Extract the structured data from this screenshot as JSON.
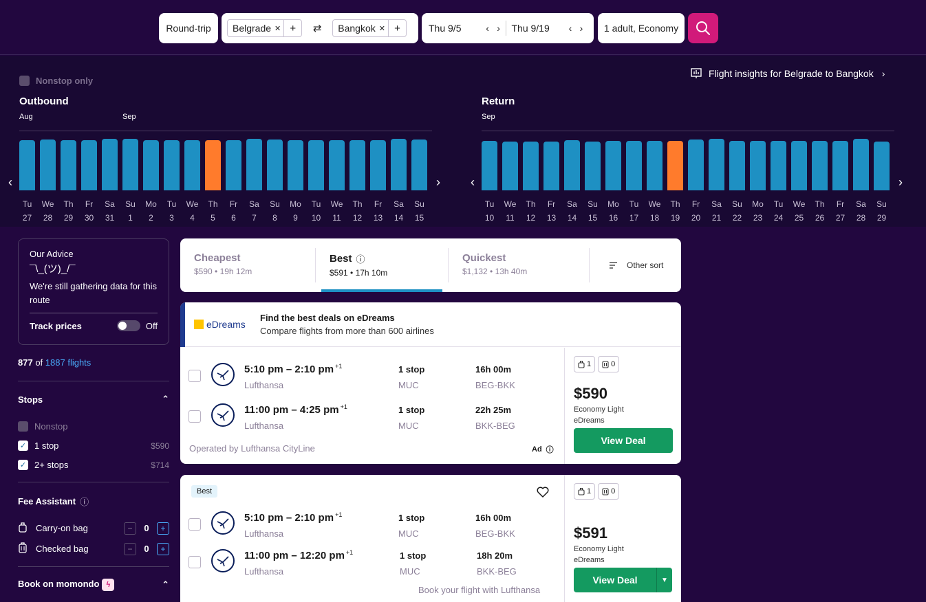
{
  "search": {
    "trip_type": "Round-trip",
    "origin": "Belgrade",
    "destination": "Bangkok",
    "depart_date": "Thu 9/5",
    "return_date": "Thu 9/19",
    "passengers": "1 adult, Economy",
    "remove_glyph": "✕",
    "add_glyph": "+",
    "swap_glyph": "⇄",
    "prev_glyph": "‹",
    "next_glyph": "›"
  },
  "calendar": {
    "nonstop_label": "Nonstop only",
    "insights_label": "Flight insights for Belgrade to Bangkok",
    "outbound": {
      "title": "Outbound",
      "months": [
        {
          "label": "Aug"
        },
        {
          "label": "Sep"
        }
      ],
      "dows": [
        "Tu",
        "We",
        "Th",
        "Fr",
        "Sa",
        "Su",
        "Mo",
        "Tu",
        "We",
        "Th",
        "Fr",
        "Sa",
        "Su",
        "Mo",
        "Tu",
        "We",
        "Th",
        "Fr",
        "Sa",
        "Su"
      ],
      "dates": [
        "27",
        "28",
        "29",
        "30",
        "31",
        "1",
        "2",
        "3",
        "4",
        "5",
        "6",
        "7",
        "8",
        "9",
        "10",
        "11",
        "12",
        "13",
        "14",
        "15"
      ],
      "selected_index": 9
    },
    "return": {
      "title": "Return",
      "months": [
        {
          "label": "Sep"
        }
      ],
      "dows": [
        "Tu",
        "We",
        "Th",
        "Fr",
        "Sa",
        "Su",
        "Mo",
        "Tu",
        "We",
        "Th",
        "Fr",
        "Sa",
        "Su",
        "Mo",
        "Tu",
        "We",
        "Th",
        "Fr",
        "Sa",
        "Su"
      ],
      "dates": [
        "10",
        "11",
        "12",
        "13",
        "14",
        "15",
        "16",
        "17",
        "18",
        "19",
        "20",
        "21",
        "22",
        "23",
        "24",
        "25",
        "26",
        "27",
        "28",
        "29"
      ],
      "selected_index": 9
    }
  },
  "sidebar": {
    "advice_title": "Our Advice",
    "advice_shrug": "¯\\_(ツ)_/¯",
    "advice_msg": "We're still gathering data for this route",
    "track_label": "Track prices",
    "track_state": "Off",
    "count_shown": "877",
    "count_of": "of",
    "count_total": "1887 flights",
    "stops_title": "Stops",
    "stops": [
      {
        "label": "Nonstop",
        "price": "",
        "checked": false,
        "disabled": true
      },
      {
        "label": "1 stop",
        "price": "$590",
        "checked": true,
        "disabled": false
      },
      {
        "label": "2+ stops",
        "price": "$714",
        "checked": true,
        "disabled": false
      }
    ],
    "fee_title": "Fee Assistant",
    "bags": [
      {
        "label": "Carry-on bag",
        "value": "0"
      },
      {
        "label": "Checked bag",
        "value": "0"
      }
    ],
    "book_title": "Book on momondo",
    "minus_glyph": "−",
    "plus_glyph": "+",
    "check_glyph": "✓",
    "info_glyph": "ⓘ",
    "collapse_glyph": "⌃",
    "bolt_glyph": "ϟ"
  },
  "sort": {
    "tabs": [
      {
        "label": "Cheapest",
        "sub": "$590 • 19h 12m"
      },
      {
        "label": "Best",
        "sub": "$591 • 17h 10m"
      },
      {
        "label": "Quickest",
        "sub": "$1,132 • 13h 40m"
      }
    ],
    "other_label": "Other sort"
  },
  "ad": {
    "brand": "eDreams",
    "headline": "Find the best deals on eDreams",
    "subline": "Compare flights from more than 600 airlines"
  },
  "results": [
    {
      "legs": [
        {
          "times": "5:10 pm – 2:10 pm",
          "plus": "+1",
          "airline": "Lufthansa",
          "stops": "1 stop",
          "via": "MUC",
          "duration": "16h 00m",
          "route": "BEG-BKK"
        },
        {
          "times": "11:00 pm – 4:25 pm",
          "plus": "+1",
          "airline": "Lufthansa",
          "stops": "1 stop",
          "via": "MUC",
          "duration": "22h 25m",
          "route": "BKK-BEG"
        }
      ],
      "operated": "Operated by Lufthansa CityLine",
      "ad_label": "Ad",
      "carry": "1",
      "checked": "0",
      "price": "$590",
      "fare": "Economy Light",
      "provider": "eDreams",
      "cta": "View Deal"
    },
    {
      "badge": "Best",
      "legs": [
        {
          "times": "5:10 pm – 2:10 pm",
          "plus": "+1",
          "airline": "Lufthansa",
          "stops": "1 stop",
          "via": "MUC",
          "duration": "16h 00m",
          "route": "BEG-BKK"
        },
        {
          "times": "11:00 pm – 12:20 pm",
          "plus": "+1",
          "airline": "Lufthansa",
          "stops": "1 stop",
          "via": "MUC",
          "duration": "18h 20m",
          "route": "BKK-BEG"
        }
      ],
      "book_with": "Book your flight with Lufthansa",
      "carry": "1",
      "checked": "0",
      "price": "$591",
      "fare": "Economy Light",
      "provider": "eDreams",
      "cta": "View Deal"
    }
  ],
  "colors": {
    "background": "#22073f",
    "calendar_bg": "#190933",
    "bar": "#1e90c3",
    "bar_selected": "#ff7b2c",
    "search_button": "#d11a7a",
    "deal_button": "#149a60"
  }
}
